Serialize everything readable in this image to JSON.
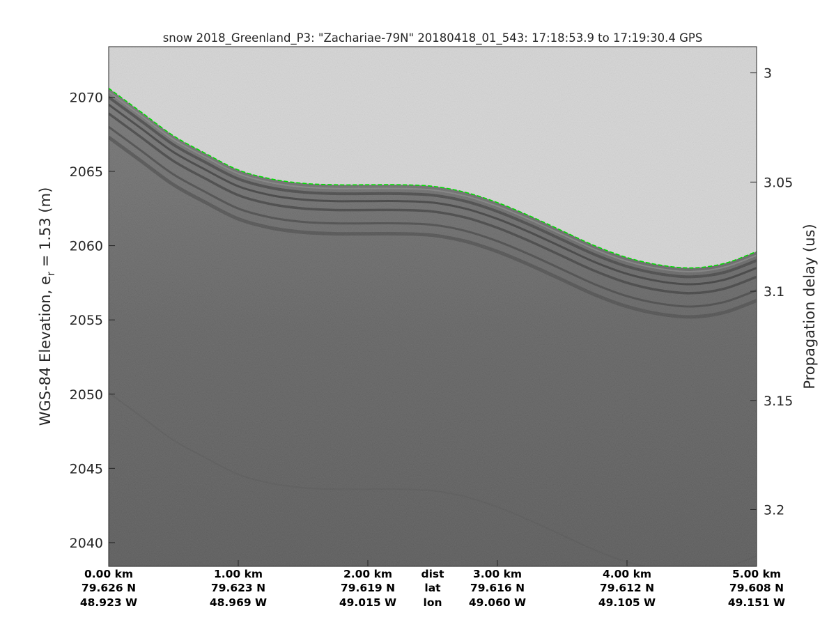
{
  "chart_data": {
    "type": "radargram",
    "title": "snow 2018_Greenland_P3: \"Zachariae-79N\"  20180418_01_543: 17:18:53.9 to 17:19:30.4 GPS",
    "ylabel_left_main": "WGS-84 Elevation, e",
    "ylabel_left_sub": "r",
    "ylabel_left_tail": " = 1.53 (m)",
    "ylabel_right": "Propagation delay (us)",
    "ylim": [
      2038.4,
      2073.4
    ],
    "yticks_left": [
      2040,
      2045,
      2050,
      2055,
      2060,
      2065,
      2070
    ],
    "ylim_right": [
      2.988,
      3.226
    ],
    "yticks_right": [
      "3",
      "3.05",
      "3.1",
      "3.15",
      "3.2"
    ],
    "x_range_km": [
      0,
      5
    ],
    "x_ticks": [
      {
        "dist": "0.00 km",
        "lat": "79.626 N",
        "lon": "48.923 W"
      },
      {
        "dist": "1.00 km",
        "lat": "79.623 N",
        "lon": "48.969 W"
      },
      {
        "dist": "2.00 km",
        "lat": "79.619 N",
        "lon": "49.015 W"
      },
      {
        "dist": "3.00 km",
        "lat": "79.616 N",
        "lon": "49.060 W"
      },
      {
        "dist": "4.00 km",
        "lat": "79.612 N",
        "lon": "49.105 W"
      },
      {
        "dist": "5.00 km",
        "lat": "79.608 N",
        "lon": "49.151 W"
      }
    ],
    "row_labels": {
      "dist": "dist",
      "lat": "lat",
      "lon": "lon"
    },
    "surface_pick": {
      "x_km": [
        0,
        0.25,
        0.5,
        0.75,
        1.0,
        1.25,
        1.5,
        1.75,
        2.0,
        2.25,
        2.5,
        2.75,
        3.0,
        3.25,
        3.5,
        3.75,
        4.0,
        4.25,
        4.5,
        4.75,
        5.0
      ],
      "elevation_m": [
        2070.6,
        2069.0,
        2067.4,
        2066.2,
        2065.1,
        2064.5,
        2064.2,
        2064.1,
        2064.1,
        2064.1,
        2064.0,
        2063.6,
        2062.9,
        2062.0,
        2061.0,
        2060.0,
        2059.2,
        2058.7,
        2058.5,
        2058.8,
        2059.6
      ],
      "color": "#00dd00"
    },
    "internal_layers_offset_m": [
      0.6,
      1.1,
      1.7,
      2.6,
      3.3
    ],
    "colors": {
      "air": "#d6d6d6",
      "ice_top": "#6a6a6a",
      "ice_deep": "#545454",
      "pick": "#00dd00"
    },
    "grid": false
  }
}
